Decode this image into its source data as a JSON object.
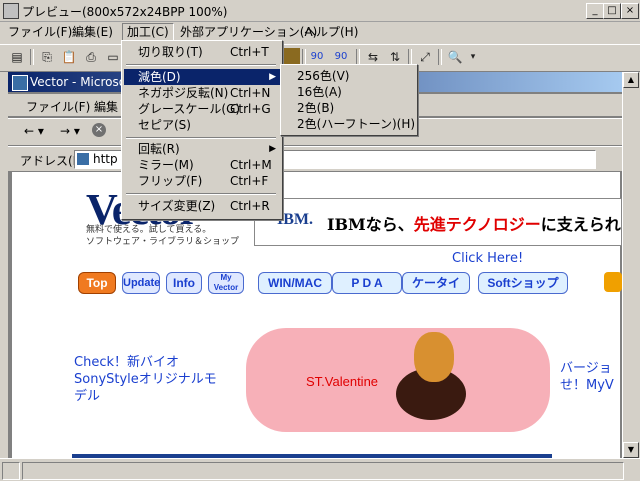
{
  "window": {
    "title": "プレビュー(800x572x24BPP 100%)",
    "min": "_",
    "max": "□",
    "close": "×"
  },
  "menubar": [
    "ファイル(F)",
    "編集(E)",
    "加工(C)",
    "外部アプリケーション(A)",
    "ヘルプ(H)"
  ],
  "toolbar": {
    "zoom_label_1": "90",
    "zoom_label_2": "90"
  },
  "edit_menu": {
    "items": [
      {
        "label": "切り取り(T)",
        "shortcut": "Ctrl+T"
      },
      {
        "label": "減色(D)",
        "shortcut": "",
        "submenu": true,
        "highlighted": true
      },
      {
        "label": "ネガポジ反転(N)",
        "shortcut": "Ctrl+N"
      },
      {
        "label": "グレースケール(G)",
        "shortcut": "Ctrl+G"
      },
      {
        "label": "セピア(S)",
        "shortcut": ""
      },
      {
        "label": "回転(R)",
        "shortcut": "",
        "submenu": true
      },
      {
        "label": "ミラー(M)",
        "shortcut": "Ctrl+M"
      },
      {
        "label": "フリップ(F)",
        "shortcut": "Ctrl+F"
      },
      {
        "label": "サイズ変更(Z)",
        "shortcut": "Ctrl+R"
      }
    ]
  },
  "color_submenu": [
    "256色(V)",
    "16色(A)",
    "2色(B)",
    "2色(ハーフトーン)(H)"
  ],
  "browser": {
    "title": "Vector - Microso",
    "menu": [
      "ファイル(F)",
      "編集"
    ],
    "address_label": "アドレス(D)",
    "address_value": "http"
  },
  "page": {
    "logo": "Vector",
    "logo_tagline_1": "無料で使える。試して買える。",
    "logo_tagline_2": "ソフトウェア・ライブラリ＆ショップ",
    "banner_brand": "IBM.",
    "banner_text_1": "IBMなら、",
    "banner_text_2": "先進テクノロジー",
    "banner_text_3": "に支えられ",
    "click_here": "Click Here!",
    "nav": [
      "Top",
      "Update",
      "Info",
      "My Vector",
      "WIN/MAC",
      "P D A",
      "ケータイ",
      "Softショップ"
    ],
    "left_text_1": "Check！新バイオ",
    "left_text_2": "SonyStyleオリジナルモ",
    "left_text_3": "デル",
    "valentine": "ST.Valentine",
    "right_text_1": "バージョ",
    "right_text_2": "せ！MyV"
  },
  "colors": {
    "highlight": "#0a246a",
    "face": "#d4d0c8",
    "link": "#1a3fcf",
    "orange": "#f07a20",
    "red": "#e00000"
  }
}
